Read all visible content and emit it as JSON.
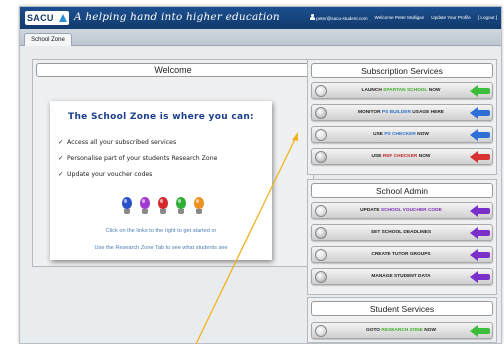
{
  "header": {
    "logo": "SACU",
    "tagline": "A helping hand into higher education",
    "user_email": "peter@sacu-student.com",
    "welcome_text": "Welcome Peter Mulligan",
    "update_profile": "Update Your Profile",
    "logout": "[ Logout ]"
  },
  "tabs": [
    {
      "label": "School Zone"
    }
  ],
  "welcome": {
    "heading": "Welcome",
    "card_title": "The School Zone is where you can:",
    "items": [
      "Access all your subscribed services",
      "Personalise part of your students Research Zone",
      "Update your voucher codes"
    ],
    "tick": "✓",
    "hint_1": "Click on the links to the right to get started or",
    "hint_2": "Use the Research Zone Tab to see what students see",
    "bulbs": [
      "blue-bulb-icon",
      "purple-bulb-icon",
      "red-bulb-icon",
      "green-bulb-icon",
      "orange-bulb-icon"
    ]
  },
  "subscription": {
    "heading": "Subscription Services",
    "items": [
      {
        "pre": "LAUNCH ",
        "accent": "SPARTAN SCHOOL",
        "post": " NOW",
        "accent_color": "#3fae2a",
        "arrow_color": "#3bbf3b",
        "icon": "spartan-icon"
      },
      {
        "pre": "MONITOR ",
        "accent": "PS BUILDER",
        "post": " USAGE HERE",
        "accent_color": "#2c6fc9",
        "arrow_color": "#2e6fd6",
        "icon": "ps-builder-icon"
      },
      {
        "pre": "USE ",
        "accent": "PS CHECKER",
        "post": " NOW",
        "accent_color": "#2c6fc9",
        "arrow_color": "#2e6fd6",
        "icon": "ps-checker-icon"
      },
      {
        "pre": "USE ",
        "accent": "REF CHECKER",
        "post": " NOW",
        "accent_color": "#c02a2a",
        "arrow_color": "#d83232",
        "icon": "ref-checker-icon"
      }
    ]
  },
  "school_admin": {
    "heading": "School Admin",
    "items": [
      {
        "pre": "UPDATE ",
        "accent": "SCHOOL VOUCHER CODE",
        "post": "",
        "accent_color": "#7b2fb5",
        "arrow_color": "#7b2fc9",
        "icon": "voucher-icon"
      },
      {
        "pre": "SET SCHOOL DEADLINES",
        "accent": "",
        "post": "",
        "accent_color": "#7b2fb5",
        "arrow_color": "#7b2fc9",
        "icon": "deadlines-icon"
      },
      {
        "pre": "CREATE TUTOR GROUPS",
        "accent": "",
        "post": "",
        "accent_color": "#7b2fb5",
        "arrow_color": "#7b2fc9",
        "icon": "tutor-groups-icon"
      },
      {
        "pre": "MANAGE STUDENT DATA",
        "accent": "",
        "post": "",
        "accent_color": "#7b2fb5",
        "arrow_color": "#7b2fc9",
        "icon": "student-data-icon"
      }
    ]
  },
  "student_services": {
    "heading": "Student Services",
    "items": [
      {
        "pre": "GOTO ",
        "accent": "RESEARCH ZONE",
        "post": " NOW",
        "accent_color": "#3fae2a",
        "arrow_color": "#3bbf3b",
        "icon": "research-zone-icon"
      }
    ]
  },
  "colors": {
    "header_bg": "#1b4f8f",
    "card_title": "#1c3e8c",
    "pointer_line": "#f2b21c"
  }
}
